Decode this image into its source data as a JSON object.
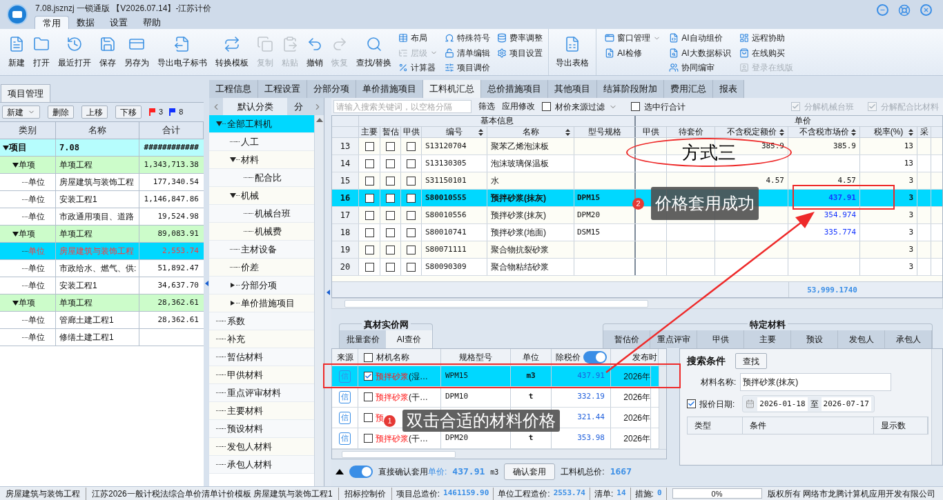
{
  "window": {
    "title": "7.08.jsznzj 一锁通版 【V2026.07.14】-江苏计价"
  },
  "menu_tabs": [
    {
      "label": "常用",
      "selected": true
    },
    {
      "label": "数据",
      "selected": false
    },
    {
      "label": "设置",
      "selected": false
    },
    {
      "label": "帮助",
      "selected": false
    }
  ],
  "ribbon": {
    "large_buttons": [
      {
        "label": "新建",
        "disabled": false
      },
      {
        "label": "打开",
        "disabled": false
      },
      {
        "label": "最近打开",
        "disabled": false
      },
      {
        "label": "保存",
        "disabled": false
      },
      {
        "label": "另存为",
        "disabled": false
      },
      {
        "label": "导出电子标书",
        "disabled": false
      },
      {
        "label": "转换模板",
        "disabled": false
      },
      {
        "label": "复制",
        "disabled": true
      },
      {
        "label": "粘贴",
        "disabled": true
      },
      {
        "label": "撤销",
        "disabled": false
      },
      {
        "label": "恢复",
        "disabled": true
      },
      {
        "label": "查找/替换",
        "disabled": false
      }
    ],
    "small_columns": [
      [
        {
          "label": "布局",
          "disabled": false
        },
        {
          "label": "层级",
          "disabled": true,
          "dropdown": true
        },
        {
          "label": "计算器",
          "disabled": false
        }
      ],
      [
        {
          "label": "特殊符号",
          "disabled": false
        },
        {
          "label": "清单编辑",
          "disabled": false
        },
        {
          "label": "项目调价",
          "disabled": false
        }
      ],
      [
        {
          "label": "费率调整",
          "disabled": false
        },
        {
          "label": "项目设置",
          "disabled": false
        }
      ]
    ],
    "export_button": {
      "label": "导出表格"
    },
    "right_columns": [
      [
        {
          "label": "窗口管理",
          "disabled": false,
          "dropdown": true
        },
        {
          "label": "AI检修",
          "disabled": false
        }
      ],
      [
        {
          "label": "AI自动组价",
          "disabled": false
        },
        {
          "label": "AI大数据标识",
          "disabled": false
        },
        {
          "label": "协同编审",
          "disabled": false
        }
      ],
      [
        {
          "label": "远程协助",
          "disabled": false
        },
        {
          "label": "在线购买",
          "disabled": false
        },
        {
          "label": "登录在线版",
          "disabled": true
        }
      ]
    ]
  },
  "project_panel": {
    "tab": "项目管理",
    "buttons": [
      {
        "label": "新建",
        "dropdown": true
      },
      {
        "label": "删除"
      },
      {
        "label": "上移"
      },
      {
        "label": "下移"
      }
    ],
    "flags": [
      {
        "color": "#ff2020",
        "count": "3"
      },
      {
        "color": "#1030ff",
        "count": "8"
      }
    ],
    "columns": [
      "类别",
      "名称",
      "合计"
    ],
    "tree": [
      {
        "category": "项目",
        "name": "7.08",
        "total": "############",
        "selected": false,
        "expanded": true,
        "children": [
          {
            "category": "单项",
            "name": "单项工程",
            "total": "1,343,713.38",
            "selected": false,
            "expanded": true,
            "children": [
              {
                "category": "单位",
                "name": "房屋建筑与装饰工程",
                "total": "177,340.54",
                "selected": false
              },
              {
                "category": "单位",
                "name": "安装工程1",
                "total": "1,146,847.86",
                "selected": false
              },
              {
                "category": "单位",
                "name": "市政通用项目、道路",
                "total": "19,524.98",
                "selected": false
              }
            ]
          },
          {
            "category": "单项",
            "name": "单项工程",
            "total": "89,083.91",
            "selected": false,
            "expanded": true,
            "children": [
              {
                "category": "单位",
                "name": "房屋建筑与装饰工程",
                "total": "2,553.74",
                "selected": true
              },
              {
                "category": "单位",
                "name": "市政给水、燃气、供:",
                "total": "51,892.47",
                "selected": false
              },
              {
                "category": "单位",
                "name": "安装工程1",
                "total": "34,637.70",
                "selected": false
              }
            ]
          },
          {
            "category": "单项",
            "name": "单项工程",
            "total": "28,362.61",
            "selected": false,
            "expanded": true,
            "children": [
              {
                "category": "单位",
                "name": "管廊土建工程1",
                "total": "28,362.61",
                "selected": false
              },
              {
                "category": "单位",
                "name": "修缮土建工程1",
                "selected": false
              }
            ]
          }
        ]
      }
    ]
  },
  "main_tabs": [
    {
      "label": "工程信息",
      "selected": false
    },
    {
      "label": "工程设置",
      "selected": false
    },
    {
      "label": "分部分项",
      "selected": false
    },
    {
      "label": "单价措施项目",
      "selected": false
    },
    {
      "label": "工料机汇总",
      "selected": true
    },
    {
      "label": "总价措施项目",
      "selected": false
    },
    {
      "label": "其他项目",
      "selected": false
    },
    {
      "label": "结算阶段附加",
      "selected": false
    },
    {
      "label": "费用汇总",
      "selected": false
    },
    {
      "label": "报表",
      "selected": false
    }
  ],
  "category_panel": {
    "tabs": [
      {
        "label": "默认分类",
        "selected": true
      },
      {
        "label": "分",
        "selected": false
      }
    ],
    "tree": [
      {
        "label": "全部工料机",
        "selected": true,
        "expanded": true,
        "children": [
          {
            "label": "人工",
            "selected": false
          },
          {
            "label": "材料",
            "selected": false,
            "expanded": true,
            "children": [
              {
                "label": "配合比",
                "selected": false
              }
            ]
          },
          {
            "label": "机械",
            "selected": false,
            "expanded": true,
            "children": [
              {
                "label": "机械台班",
                "selected": false
              },
              {
                "label": "机械费",
                "selected": false
              }
            ]
          },
          {
            "label": "主材设备",
            "selected": false
          },
          {
            "label": "价差",
            "selected": false
          },
          {
            "label": "分部分项",
            "selected": false,
            "expanded": false
          },
          {
            "label": "单价措施项目",
            "selected": false,
            "expanded": false
          }
        ]
      },
      {
        "label": "系数",
        "selected": false
      },
      {
        "label": "补充",
        "selected": false
      },
      {
        "label": "暂估材料",
        "selected": false
      },
      {
        "label": "甲供材料",
        "selected": false
      },
      {
        "label": "重点评审材料",
        "selected": false
      },
      {
        "label": "主要材料",
        "selected": false
      },
      {
        "label": "预设材料",
        "selected": false
      },
      {
        "label": "发包人材料",
        "selected": false
      },
      {
        "label": "承包人材料",
        "selected": false
      }
    ]
  },
  "toolbar": {
    "search": {
      "placeholder": "请输入搜索关键词，以空格分隔"
    },
    "buttons": [
      "筛选",
      "应用修改"
    ],
    "checks": [
      {
        "label": "材价来源过滤",
        "checked": false,
        "disabled": false,
        "dropdown": true
      },
      {
        "label": "选中行合计",
        "checked": false,
        "disabled": false
      },
      {
        "label": "分解机械台班",
        "checked": true,
        "disabled": true
      },
      {
        "label": "分解配合比材料",
        "checked": true,
        "disabled": true
      }
    ]
  },
  "table": {
    "groups": [
      "基本信息",
      "单价"
    ],
    "columns": [
      {
        "label": "主要",
        "sortable": false
      },
      {
        "label": "暂估",
        "sortable": false
      },
      {
        "label": "甲供",
        "sortable": false
      },
      {
        "label": "编号",
        "sortable": true
      },
      {
        "label": "名称",
        "sortable": true
      },
      {
        "label": "型号规格",
        "sortable": false
      },
      {
        "label": "甲供",
        "sortable": false
      },
      {
        "label": "待套价",
        "sortable": false
      },
      {
        "label": "不含税定额价",
        "sortable": true
      },
      {
        "label": "不含税市场价",
        "sortable": true
      },
      {
        "label": "税率(%)",
        "sortable": true
      },
      {
        "label": "采",
        "sortable": false
      }
    ],
    "rows": [
      {
        "no": "13",
        "main": false,
        "estimate": false,
        "owner": false,
        "code": "S13120704",
        "name": "聚苯乙烯泡沫板",
        "spec": "",
        "quota_price": "385.9",
        "market_price": "385.9",
        "adjusted": false,
        "tax": "13",
        "selected": false
      },
      {
        "no": "14",
        "main": false,
        "estimate": false,
        "owner": false,
        "code": "S13130305",
        "name": "泡沫玻璃保温板",
        "spec": "",
        "quota_price": "",
        "market_price": "",
        "tax": "13",
        "selected": false
      },
      {
        "no": "15",
        "main": false,
        "estimate": false,
        "owner": false,
        "code": "S31150101",
        "name": "水",
        "spec": "",
        "quota_price": "4.57",
        "market_price": "4.57",
        "adjusted": false,
        "tax": "3",
        "selected": false
      },
      {
        "no": "16",
        "main": false,
        "estimate": false,
        "owner": false,
        "code": "S80010555",
        "name": "预拌砂浆(抹灰)",
        "spec": "DPM15",
        "quota_price": "",
        "market_price": "437.91",
        "adjusted": true,
        "tax": "3",
        "selected": true
      },
      {
        "no": "17",
        "main": false,
        "estimate": false,
        "owner": false,
        "code": "S80010556",
        "name": "预拌砂浆(抹灰)",
        "spec": "DPM20",
        "quota_price": "",
        "market_price": "354.974",
        "adjusted": true,
        "tax": "3",
        "selected": false
      },
      {
        "no": "18",
        "main": false,
        "estimate": false,
        "owner": false,
        "code": "S80010741",
        "name": "预拌砂浆(地面)",
        "spec": "DSM15",
        "quota_price": "",
        "market_price": "335.774",
        "adjusted": true,
        "tax": "3",
        "selected": false
      },
      {
        "no": "19",
        "main": false,
        "estimate": false,
        "owner": false,
        "code": "S80071111",
        "name": "聚合物抗裂砂浆",
        "spec": "",
        "quota_price": "",
        "market_price": "",
        "tax": "3",
        "selected": false
      },
      {
        "no": "20",
        "main": false,
        "estimate": false,
        "owner": false,
        "code": "S80090309",
        "name": "聚合物粘结砂浆",
        "spec": "",
        "quota_price": "",
        "market_price": "",
        "tax": "3",
        "selected": false
      }
    ],
    "footer_total": "53,999.1740"
  },
  "price_net": {
    "title": "真材实价网",
    "tabs": [
      {
        "label": "批量套价",
        "selected": false
      },
      {
        "label": "AI查价",
        "selected": true
      }
    ],
    "columns": [
      "来源",
      "材机名称",
      "规格型号",
      "单位",
      "除税价",
      "发布时"
    ],
    "select_all_checked": false,
    "tax_toggle_on": true,
    "rows": [
      {
        "source": "信",
        "checked": true,
        "name": "预拌砂浆(湿…",
        "spec": "WPM15",
        "unit": "m3",
        "price": "437.91",
        "date": "2026年",
        "selected": true
      },
      {
        "source": "信",
        "checked": false,
        "name": "预拌砂浆(干…",
        "spec": "DPM10",
        "unit": "t",
        "price": "332.19",
        "date": "2026年",
        "selected": false
      },
      {
        "source": "信",
        "checked": false,
        "name": "预",
        "price": "321.44",
        "date": "2026年",
        "selected": false
      },
      {
        "source": "信",
        "checked": false,
        "name": "预拌砂浆(干…",
        "spec": "DPM20",
        "unit": "t",
        "price": "353.98",
        "date": "2026年",
        "selected": false
      }
    ],
    "footer": {
      "toggle_on": true,
      "label": "直接确认套用",
      "price_label": "单价:",
      "price": "437.91",
      "unit": "m3",
      "button": "确认套用",
      "total_label": "工料机总价:",
      "total": "1667"
    }
  },
  "special_materials": {
    "title": "特定材料",
    "tabs": [
      "暂估价",
      "重点评审",
      "甲供",
      "主要",
      "预设",
      "发包人",
      "承包人"
    ],
    "search": {
      "title": "搜索条件",
      "button": "查找",
      "name_label": "材料名称:",
      "name_value": "预拌砂浆(抹灰)",
      "date_label": "报价日期:",
      "date_checked": true,
      "date_from": "2026-01-18",
      "date_sep": "至",
      "date_to": "2026-07-17"
    },
    "columns": [
      "类型",
      "条件",
      "显示数"
    ]
  },
  "status_bar": [
    "房屋建筑与装饰工程",
    "江苏2026一般计税法综合单价清单计价模板 房屋建筑与装饰工程1",
    "招标控制价"
  ],
  "status_values": [
    {
      "label": "项目总造价:",
      "value": "1461159.90"
    },
    {
      "label": "单位工程造价:",
      "value": "2553.74"
    },
    {
      "label": "清单:",
      "value": "14"
    },
    {
      "label": "措施:",
      "value": "0"
    }
  ],
  "progress": {
    "level": 0,
    "text": "0%"
  },
  "copyright": "版权所有 网络市龙腾计算机应用开发有限公司",
  "annotations": [
    {
      "kind": "ellipse",
      "text": "方式三"
    },
    {
      "kind": "callout",
      "number": "2",
      "text": "价格套用成功"
    },
    {
      "kind": "callout",
      "number": "1",
      "text": "双击合适的材料价格"
    }
  ]
}
